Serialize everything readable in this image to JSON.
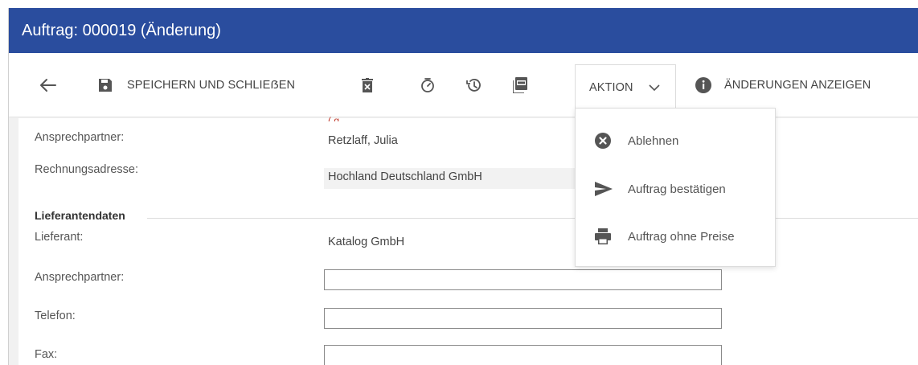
{
  "window": {
    "title": "Auftrag: 000019 (Änderung)"
  },
  "toolbar": {
    "save_label": "SPEICHERN UND SCHLIEẞEN",
    "aktion_label": "AKTION",
    "show_changes_label": "ÄNDERUNGEN ANZEIGEN"
  },
  "form": {
    "contact_label": "Ansprechpartner:",
    "contact_value": "Retzlaff, Julia",
    "billing_label": "Rechnungsadresse:",
    "billing_value": "Hochland Deutschland GmbH",
    "supplier_section": "Lieferantendaten",
    "supplier_label": "Lieferant:",
    "supplier_value": "Katalog GmbH",
    "supplier_contact_label": "Ansprechpartner:",
    "supplier_contact_value": "",
    "phone_label": "Telefon:",
    "phone_value": "",
    "fax_label": "Fax:",
    "fax_value": ""
  },
  "action_menu": {
    "items": [
      {
        "label": "Ablehnen",
        "icon": "close-circle-icon"
      },
      {
        "label": "Auftrag bestätigen",
        "icon": "send-icon"
      },
      {
        "label": "Auftrag ohne Preise",
        "icon": "printer-icon"
      }
    ]
  },
  "colors": {
    "titlebar": "#2a4d9e",
    "required_marker": "#c0392b"
  }
}
